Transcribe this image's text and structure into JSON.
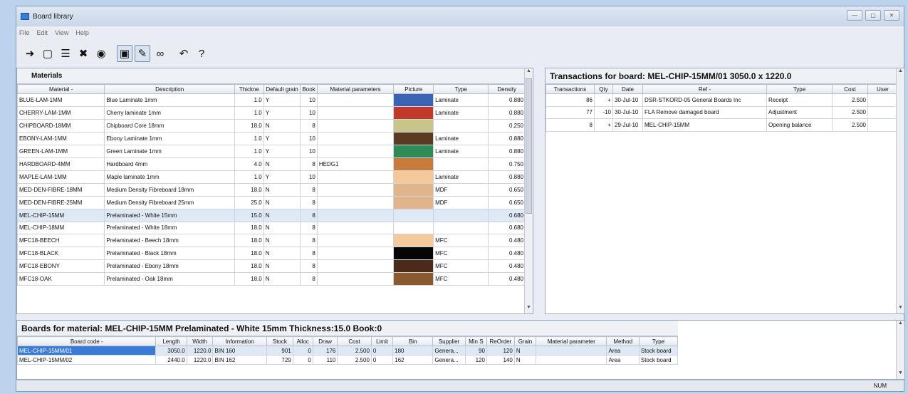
{
  "window": {
    "title": "Board library"
  },
  "menu": [
    "File",
    "Edit",
    "View",
    "Help"
  ],
  "toolbar": [
    {
      "name": "exit-icon",
      "glyph": "➜"
    },
    {
      "name": "new-icon",
      "glyph": "▢"
    },
    {
      "name": "edit-list-icon",
      "glyph": "☰"
    },
    {
      "name": "delete-icon",
      "glyph": "✖"
    },
    {
      "name": "stock-in-icon",
      "glyph": "◉"
    },
    {
      "name": "board-icon",
      "glyph": "▣"
    },
    {
      "name": "pencil-icon",
      "glyph": "✎"
    },
    {
      "name": "link-icon",
      "glyph": "∞"
    },
    {
      "name": "back-icon",
      "glyph": "↶"
    },
    {
      "name": "help-icon",
      "glyph": "?"
    }
  ],
  "materials": {
    "title": "Materials",
    "columns": [
      "Material -",
      "Description",
      "Thickne",
      "Default grain",
      "Book",
      "Material parameters",
      "Picture",
      "Type",
      "Density"
    ],
    "rows": [
      {
        "material": "BLUE-LAM-1MM",
        "description": "Blue Laminate 1mm",
        "thickness": "1.0",
        "grain": "Y",
        "book": "10",
        "params": "",
        "color": "#3b63b5",
        "type": "Laminate",
        "density": "0.880"
      },
      {
        "material": "CHERRY-LAM-1MM",
        "description": "Cherry laminate 1mm",
        "thickness": "1.0",
        "grain": "Y",
        "book": "10",
        "params": "",
        "color": "#c0392b",
        "type": "Laminate",
        "density": "0.880"
      },
      {
        "material": "CHIPBOARD-18MM",
        "description": "Chipboard Core 18mm",
        "thickness": "18.0",
        "grain": "N",
        "book": "8",
        "params": "",
        "color": "#c8c58a",
        "type": "",
        "density": "0.250"
      },
      {
        "material": "EBONY-LAM-1MM",
        "description": "Ebony Laminate 1mm",
        "thickness": "1.0",
        "grain": "Y",
        "book": "10",
        "params": "",
        "color": "#5a3a22",
        "type": "Laminate",
        "density": "0.880"
      },
      {
        "material": "GREEN-LAM-1MM",
        "description": "Green Laminate 1mm",
        "thickness": "1.0",
        "grain": "Y",
        "book": "10",
        "params": "",
        "color": "#2e8b57",
        "type": "Laminate",
        "density": "0.880"
      },
      {
        "material": "HARDBOARD-4MM",
        "description": "Hardboard 4mm",
        "thickness": "4.0",
        "grain": "N",
        "book": "8",
        "params": "HEDG1",
        "color": "#c97b3c",
        "type": "",
        "density": "0.750"
      },
      {
        "material": "MAPLE-LAM-1MM",
        "description": "Maple laminate 1mm",
        "thickness": "1.0",
        "grain": "Y",
        "book": "10",
        "params": "",
        "color": "#f5c89a",
        "type": "Laminate",
        "density": "0.880"
      },
      {
        "material": "MED-DEN-FIBRE-18MM",
        "description": "Medium Density Fibreboard 18mm",
        "thickness": "18.0",
        "grain": "N",
        "book": "8",
        "params": "",
        "color": "#e2b48b",
        "type": "MDF",
        "density": "0.650"
      },
      {
        "material": "MED-DEN-FIBRE-25MM",
        "description": "Medium Density Fibreboard 25mm",
        "thickness": "25.0",
        "grain": "N",
        "book": "8",
        "params": "",
        "color": "#e2b48b",
        "type": "MDF",
        "density": "0.650"
      },
      {
        "material": "MEL-CHIP-15MM",
        "description": "Prelaminated - White 15mm",
        "thickness": "15.0",
        "grain": "N",
        "book": "8",
        "params": "",
        "color": "#ffffff",
        "type": "",
        "density": "0.680",
        "selected": true
      },
      {
        "material": "MEL-CHIP-18MM",
        "description": "Prelaminated - White 18mm",
        "thickness": "18.0",
        "grain": "N",
        "book": "8",
        "params": "",
        "color": "#ffffff",
        "type": "",
        "density": "0.680"
      },
      {
        "material": "MFC18-BEECH",
        "description": "Prelaminated - Beech 18mm",
        "thickness": "18.0",
        "grain": "N",
        "book": "8",
        "params": "",
        "color": "#f6c99c",
        "type": "MFC",
        "density": "0.480"
      },
      {
        "material": "MFC18-BLACK",
        "description": "Prelaminated - Black 18mm",
        "thickness": "18.0",
        "grain": "N",
        "book": "8",
        "params": "",
        "color": "#050505",
        "type": "MFC",
        "density": "0.480"
      },
      {
        "material": "MFC18-EBONY",
        "description": "Prelaminated - Ebony 18mm",
        "thickness": "18.0",
        "grain": "N",
        "book": "8",
        "params": "",
        "color": "#4a2a18",
        "type": "MFC",
        "density": "0.480"
      },
      {
        "material": "MFC18-OAK",
        "description": "Prelaminated - Oak 18mm",
        "thickness": "18.0",
        "grain": "N",
        "book": "8",
        "params": "",
        "color": "#8a5a2e",
        "type": "MFC",
        "density": "0.480"
      }
    ]
  },
  "transactions": {
    "title": "Transactions for board: MEL-CHIP-15MM/01  3050.0 x 1220.0",
    "columns": [
      "Transactions",
      "Qty",
      "Date",
      "Ref -",
      "Type",
      "Cost",
      "User"
    ],
    "rows": [
      {
        "id": "86",
        "qty": "+",
        "date": "30-Jul-10",
        "ref": "DSR-STKORD-05 General Boards Inc",
        "type": "Receipt",
        "cost": "2.500",
        "user": ""
      },
      {
        "id": "77",
        "qty": "-10",
        "date": "30-Jul-10",
        "ref": "FLA Remove damaged board",
        "type": "Adjustment",
        "cost": "2.500",
        "user": ""
      },
      {
        "id": "8",
        "qty": "+",
        "date": "29-Jul-10",
        "ref": "MEL-CHIP-15MM",
        "type": "Opening balance",
        "cost": "2.500",
        "user": ""
      }
    ]
  },
  "boards": {
    "title": "Boards for material: MEL-CHIP-15MM Prelaminated - White 15mm Thickness:15.0 Book:0",
    "columns": [
      "Board code -",
      "Length",
      "Width",
      "Information",
      "Stock",
      "Alloc",
      "Draw",
      "Cost",
      "Limit",
      "Bin",
      "Supplier",
      "Min S",
      "ReOrder",
      "Grain",
      "Material parameter",
      "Method",
      "Type"
    ],
    "rows": [
      {
        "code": "MEL-CHIP-15MM/01",
        "length": "3050.0",
        "width": "1220.0",
        "info": "BIN 160",
        "stock": "901",
        "alloc": "0",
        "draw": "176",
        "cost": "2.500",
        "limit": "0",
        "bin": "180",
        "supplier": "Genera...",
        "mins": "90",
        "reorder": "120",
        "grain": "N",
        "param": "",
        "method": "Area",
        "type": "Stock board",
        "selected": true
      },
      {
        "code": "MEL-CHIP-15MM/02",
        "length": "2440.0",
        "width": "1220.0",
        "info": "BIN 162",
        "stock": "729",
        "alloc": "0",
        "draw": "110",
        "cost": "2.500",
        "limit": "0",
        "bin": "162",
        "supplier": "Genera...",
        "mins": "120",
        "reorder": "140",
        "grain": "N",
        "param": "",
        "method": "Area",
        "type": "Stock board"
      }
    ]
  },
  "status": {
    "mode": "NUM"
  }
}
